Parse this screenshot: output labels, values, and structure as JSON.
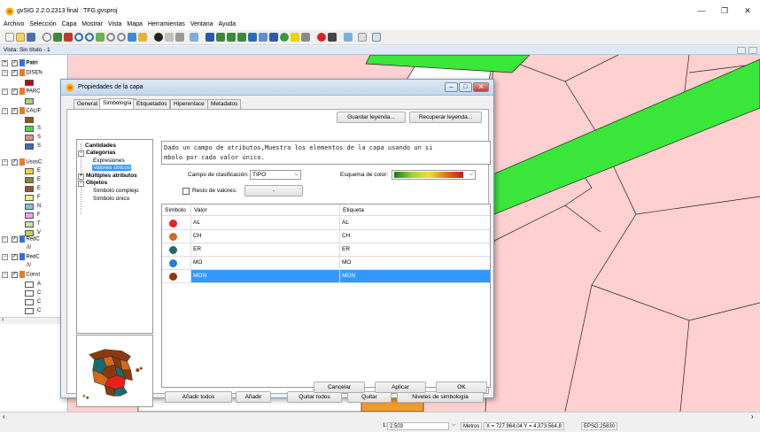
{
  "window": {
    "title": "gvSIG 2.2.0.2313 final : TFG.gvsproj",
    "controls": [
      "—",
      "❐",
      "✕"
    ]
  },
  "menu": [
    "Archivo",
    "Selección",
    "Capa",
    "Mostrar",
    "Vista",
    "Mapa",
    "Herramientas",
    "Ventana",
    "Ayuda"
  ],
  "view": {
    "title": "Vista: Sin título - 1"
  },
  "toc": {
    "layers": [
      {
        "label": "Patri",
        "bold": true
      },
      {
        "label": "DISEN"
      },
      {
        "label": "PARC"
      },
      {
        "label": "CALIF"
      },
      {
        "label": "UsosC"
      },
      {
        "label": "RedC"
      },
      {
        "label": "RedC"
      },
      {
        "label": "Const"
      }
    ],
    "legend_letters": [
      "S",
      "S",
      "S",
      "E",
      "E",
      "E",
      "F",
      "N",
      "F",
      "T",
      "V",
      "A",
      "C",
      "C",
      "C"
    ]
  },
  "dialog": {
    "title": "Propiedades de la capa",
    "tabs": [
      "General",
      "Simbología",
      "Etiquetados",
      "Hiperenlace",
      "Metadatos"
    ],
    "active_tab": "Simbología",
    "save_legend": "Guardar leyenda...",
    "load_legend": "Recuperar leyenda...",
    "tree": {
      "cantidades": "Cantidades",
      "categorias": "Categorías",
      "expresiones": "Expresiones",
      "valores_unicos": "Valores únicos",
      "multiples": "Múltiples atributos",
      "objetos": "Objetos",
      "simbolo_complejo": "Símbolo complejo",
      "simbolo_unico": "Símbolo único"
    },
    "description_line1": "Dado un campo de atributos,Muestra los elementos de la capa usando un si",
    "description_line2": "mbolo por cada valor único.",
    "classification_label": "Campo de clasificación:",
    "classification_value": "TIPO",
    "color_scheme_label": "Esquema de color:",
    "rest_label": "Resto de valores:",
    "rest_value": "-",
    "table": {
      "headers": [
        "Símbolo",
        "Valor",
        "Etiqueta"
      ],
      "rows": [
        {
          "valor": "AL",
          "etiqueta": "AL",
          "color": "#e8211f"
        },
        {
          "valor": "CH",
          "etiqueta": "CH",
          "color": "#d2691e"
        },
        {
          "valor": "ER",
          "etiqueta": "ER",
          "color": "#1c6b6b"
        },
        {
          "valor": "MO",
          "etiqueta": "MO",
          "color": "#1f7fd4"
        },
        {
          "valor": "MON",
          "etiqueta": "MON",
          "color": "#8b3a10"
        }
      ],
      "selected_row": "MON"
    },
    "buttons": {
      "add_all": "Añadir todos",
      "add": "Añadir",
      "remove_all": "Quitar todos",
      "remove": "Quitar",
      "levels": "Niveles de simbología",
      "cancel": "Cancelar",
      "apply": "Aplicar",
      "ok": "OK"
    }
  },
  "status": {
    "scale_prefix": "1:",
    "scale": "2.503",
    "units": "Metros",
    "coords": "X = 727.964,04 Y = 4.373.564,8",
    "epsg": "EPSG:25830"
  },
  "colors": {
    "map_background": "#ffd0d0",
    "road_green": "#39e639",
    "selection_blue": "#3399ff",
    "dialog_border": "#7a9cc4"
  }
}
